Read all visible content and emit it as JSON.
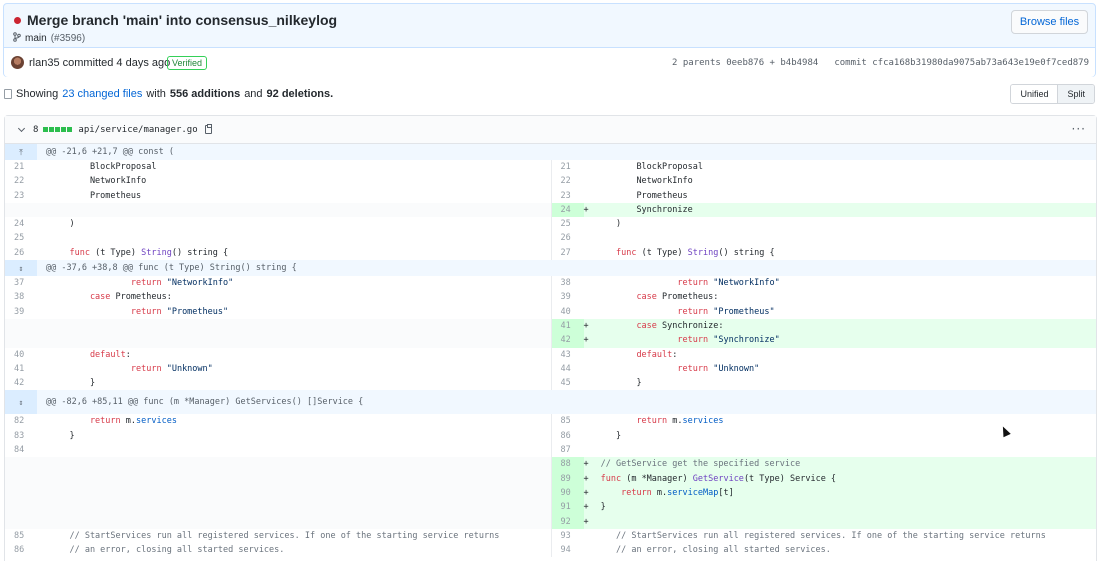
{
  "commit": {
    "title": "Merge branch 'main' into consensus_nilkeylog",
    "branch": "main",
    "pr": "(#3596)",
    "browse_label": "Browse files",
    "author_line": "rlan35 committed 4 days ago",
    "verified": "Verified",
    "parents": "2 parents 0eeb876 + b4b4984",
    "commit_hash": "commit cfca168b31980da9075ab73a643e19e0f7ced879"
  },
  "summary": {
    "prefix": "Showing",
    "files_link": "23 changed files",
    "with": "with",
    "additions": "556 additions",
    "and": "and",
    "deletions": "92 deletions."
  },
  "view_toggle": {
    "unified": "Unified",
    "split": "Split"
  },
  "file": {
    "count": "8",
    "path": "api/service/manager.go",
    "more": "···"
  },
  "hunks": [
    "@@ -21,6 +21,7 @@ const (",
    "@@ -37,6 +38,8 @@ func (t Type) String() string {",
    "@@ -82,6 +85,11 @@ func (m *Manager) GetServices() []Service {"
  ],
  "lines": {
    "l21": "21",
    "l22": "22",
    "l23": "23",
    "l24": "24",
    "l25": "25",
    "l26": "26",
    "l37": "37",
    "l38": "38",
    "l39": "39",
    "l40": "40",
    "l41": "41",
    "l42": "42",
    "l82": "82",
    "l83": "83",
    "l84": "84",
    "l85": "85",
    "l86": "86",
    "r21": "21",
    "r22": "22",
    "r23": "23",
    "r24": "24",
    "r25": "25",
    "r26": "26",
    "r27": "27",
    "r38": "38",
    "r39": "39",
    "r40": "40",
    "r41": "41",
    "r42": "42",
    "r43": "43",
    "r44": "44",
    "r45": "45",
    "r85": "85",
    "r86": "86",
    "r87": "87",
    "r88": "88",
    "r89": "89",
    "r90": "90",
    "r91": "91",
    "r92": "92",
    "r93": "93",
    "r94": "94"
  },
  "code": {
    "block_proposal": "        BlockProposal",
    "network_info": "        NetworkInfo",
    "prometheus": "        Prometheus",
    "synchronize": "        Synchronize",
    "close_paren": "    )",
    "func_string_kw": "    func",
    "func_string_rest": " (t Type) ",
    "func_string_name": "String",
    "func_string_tail": "() string {",
    "return_kw": "                return",
    "ret_network": " \"NetworkInfo\"",
    "case_kw": "        case",
    "case_prom": " Prometheus:",
    "ret_prom": " \"Prometheus\"",
    "case_sync": " Synchronize:",
    "ret_sync": " \"Synchronize\"",
    "default_kw": "        default",
    "default_colon": ":",
    "ret_unknown": " \"Unknown\"",
    "brace": "        }",
    "return_m": "        return",
    "m_dot": " m.",
    "services": "services",
    "close_brace": "    }",
    "comment_getservice": " // GetService get the specified service",
    "func_kw": " func",
    "getservice_recv": " (m *Manager) ",
    "getservice_name": "GetService",
    "getservice_tail": "(t Type) Service {",
    "return_svc_kw": "     return",
    "m_dot2": " m.",
    "service_map": "serviceMap",
    "service_map_idx": "[t]",
    "close_brace_add": " }",
    "comment_start1": "    // StartServices run all registered services. If one of the starting service returns",
    "comment_start2": "    // an error, closing all started services."
  }
}
